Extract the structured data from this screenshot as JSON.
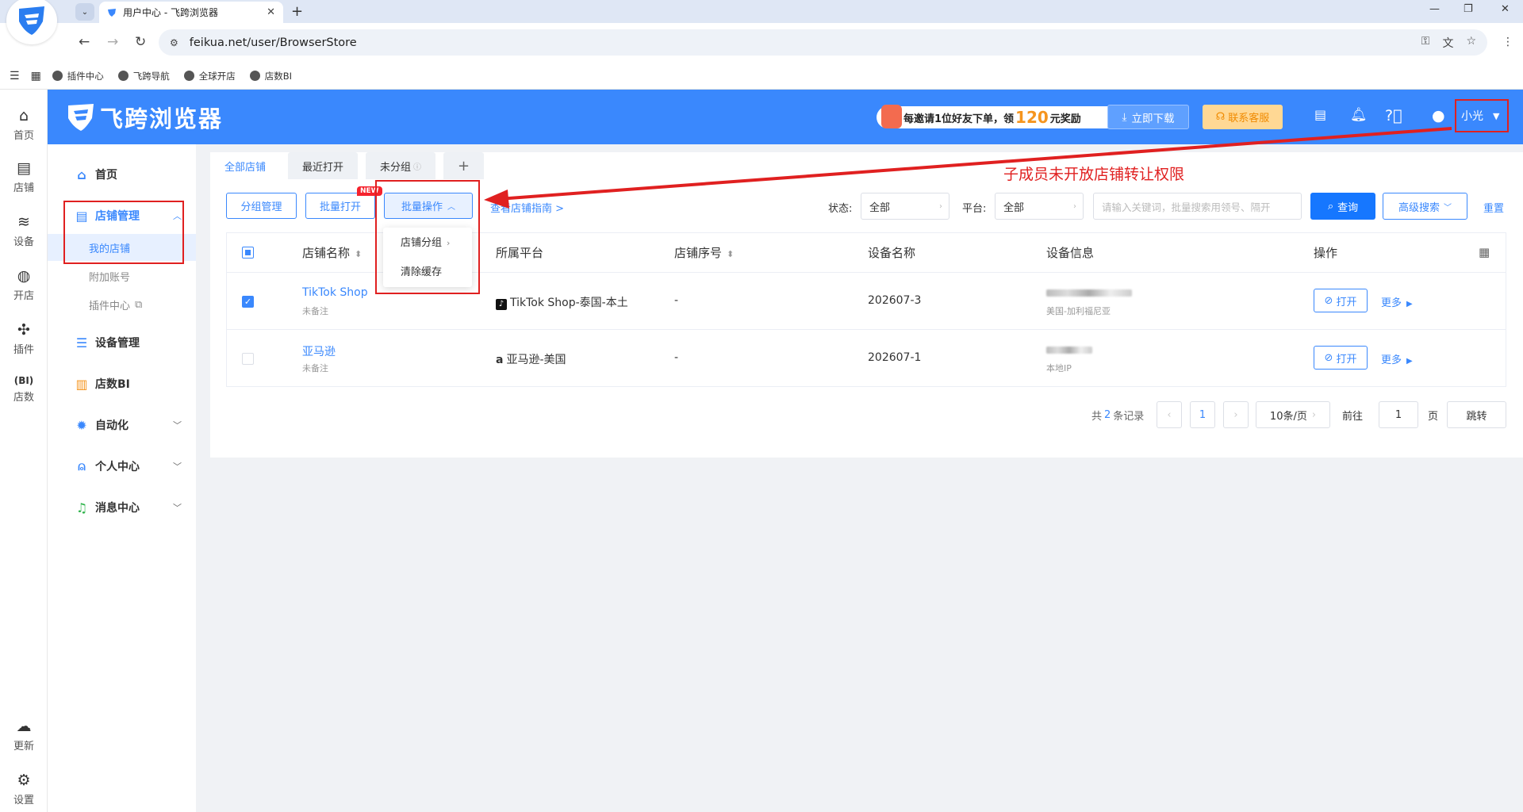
{
  "browser": {
    "tab_title": "用户中心 - 飞跨浏览器",
    "url": "feikua.net/user/BrowserStore",
    "bookmarks": [
      "插件中心",
      "飞跨导航",
      "全球开店",
      "店数BI"
    ]
  },
  "rail": {
    "items": [
      "首页",
      "店铺",
      "设备",
      "开店",
      "插件",
      "店数"
    ],
    "bottom": [
      "更新",
      "设置"
    ]
  },
  "header": {
    "brand": "飞跨浏览器",
    "promo_pre": "每邀请1位好友下单，领",
    "promo_num": "120",
    "promo_post": "元奖励",
    "download": "立即下载",
    "support": "联系客服",
    "username": "小光"
  },
  "sidebar": {
    "home": "首页",
    "store_mgmt": "店铺管理",
    "my_stores": "我的店铺",
    "extra_accounts": "附加账号",
    "plugin_center": "插件中心",
    "device_mgmt": "设备管理",
    "bi": "店数BI",
    "automation": "自动化",
    "personal": "个人中心",
    "messages": "消息中心"
  },
  "tabs": [
    "全部店铺",
    "最近打开",
    "未分组"
  ],
  "toolbar": {
    "group_mgmt": "分组管理",
    "batch_open": "批量打开",
    "batch_ops": "批量操作",
    "new_badge": "NEW",
    "guide": "查看店铺指南 >",
    "status_label": "状态:",
    "status_value": "全部",
    "platform_label": "平台:",
    "platform_value": "全部",
    "search_placeholder": "请输入关键词，批量搜索用领号、隔开",
    "query": "查询",
    "advanced": "高级搜索",
    "reset": "重置"
  },
  "dropdown": {
    "items": [
      "店铺分组",
      "清除缓存"
    ]
  },
  "table": {
    "headers": [
      "店铺名称",
      "所属平台",
      "店铺序号",
      "设备名称",
      "设备信息",
      "操作"
    ],
    "rows": [
      {
        "name": "TikTok Shop",
        "note": "未备注",
        "platform": "TikTok Shop-泰国-本土",
        "seq": "-",
        "device": "202607-3",
        "device_info": "美国-加利福尼亚",
        "open": "打开",
        "more": "更多"
      },
      {
        "name": "亚马逊",
        "note": "未备注",
        "platform": "亚马逊-美国",
        "seq": "-",
        "device": "202607-1",
        "device_info": "本地IP",
        "open": "打开",
        "more": "更多"
      }
    ]
  },
  "pagination": {
    "total_pre": "共",
    "total": "2",
    "total_post": "条记录",
    "page": "1",
    "page_size": "10条/页",
    "goto_label": "前往",
    "goto_value": "1",
    "page_unit": "页",
    "jump": "跳转"
  },
  "annotation": {
    "text": "子成员未开放店铺转让权限",
    "color": "#e02020"
  },
  "colors": {
    "primary": "#3a88fd",
    "header_bg": "#3a88fd"
  }
}
